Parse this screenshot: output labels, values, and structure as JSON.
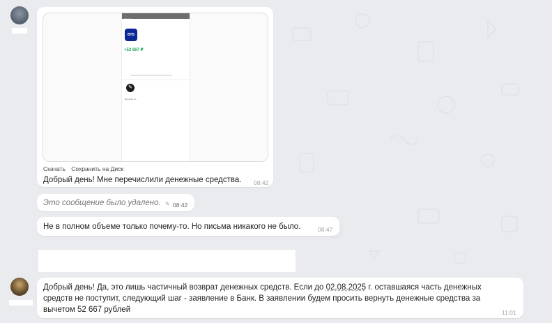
{
  "colors": {
    "background": "#e9ebee",
    "bubble": "#ffffff",
    "amount_green": "#1aa45a",
    "vtb_blue": "#0a2896",
    "timestamp": "#a3a3a3"
  },
  "attachment": {
    "phone_status_time": "08:42",
    "bank_logo_text": "ВТБ",
    "amount": "+52 667 ₽",
    "pen_caption": "Выписка по...",
    "links": [
      "Скачать",
      "Сохранить на Диск"
    ]
  },
  "messages": [
    {
      "text": "Добрый день! Мне перечислили денежные средства.",
      "time": "08:42"
    },
    {
      "text": "Это сообщение было удалено.",
      "time": "08:42",
      "deleted": true,
      "icon": "pencil-icon"
    },
    {
      "text": "Не в полном объеме только почему-то. Но письма никакого не было.",
      "time": "08:47"
    }
  ],
  "reply": {
    "lines": [
      "Добрый день! Да, это лишь частичный возврат денежных средств. Если до ",
      "02.08.2025",
      " г. оставшаяся часть денежных",
      "средств не поступит, следующий шаг - заявление в Банк. В заявлении будем просить вернуть денежные средства за",
      "вычетом 52 667 рублей"
    ],
    "time": "11:01"
  }
}
